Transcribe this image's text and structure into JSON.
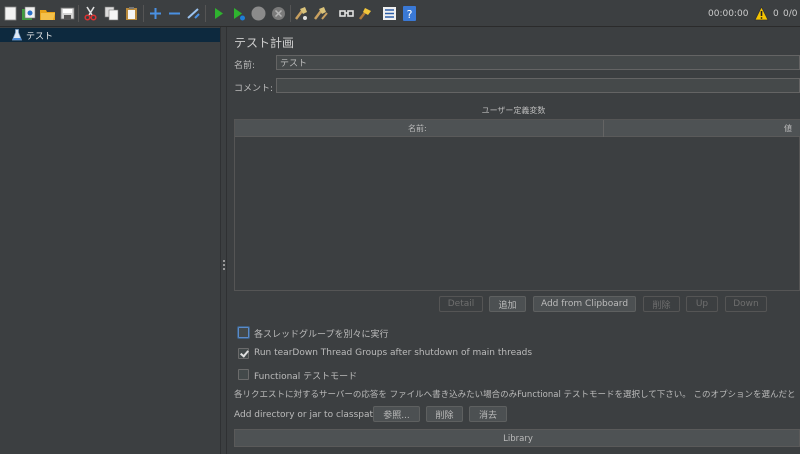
{
  "toolbar": {
    "timer": "00:00:00",
    "warning_count": "0",
    "progress": "0/0",
    "icons": [
      "new-icon",
      "templates-icon",
      "open-icon",
      "save-icon",
      "cut-icon",
      "copy-icon",
      "paste-icon",
      "expand-icon",
      "collapse-icon",
      "toggle-icon",
      "start-icon",
      "start-no-pause-icon",
      "stop-icon",
      "shutdown-icon",
      "clear-icon",
      "clear-all-icon",
      "search-icon",
      "reset-search-icon",
      "function-helper-icon",
      "help-icon"
    ]
  },
  "tree": {
    "root_label": "テスト"
  },
  "panel": {
    "title": "テスト計画",
    "name_label": "名前:",
    "name_value": "テスト",
    "comment_label": "コメント:",
    "comment_value": "",
    "variables_title": "ユーザー定義変数",
    "table": {
      "col_name": "名前:",
      "col_value": "値"
    },
    "buttons": {
      "detail": "Detail",
      "add": "追加",
      "add_clipboard": "Add from Clipboard",
      "delete": "削除",
      "up": "Up",
      "down": "Down"
    },
    "checks": {
      "serialize": "各スレッドグループを別々に実行",
      "teardown": "Run tearDown Thread Groups after shutdown of main threads",
      "functional": "Functional テストモード"
    },
    "functional_note": "各リクエストに対するサーバーの応答を ファイルへ書き込みたい場合のみFunctional テストモードを選択して下さい。 このオプションを選んだと",
    "classpath_label": "Add directory or jar to classpath",
    "classpath_buttons": {
      "browse": "参照...",
      "delete": "削除",
      "clear": "消去"
    },
    "library_header": "Library"
  },
  "colors": {
    "background": "#3c3f41",
    "selection": "#0d293e",
    "run": "#2fb32f",
    "warning": "#f5c400",
    "help": "#3a79d6"
  }
}
